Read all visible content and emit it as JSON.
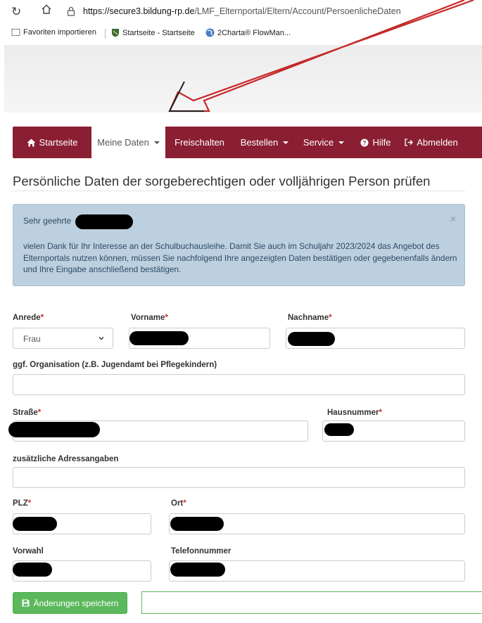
{
  "browser": {
    "url_host": "https://secure3.bildung-rp.de",
    "url_path": "/LMF_Elternportal/Eltern/Account/PersoenlicheDaten",
    "favorites": [
      {
        "label": "Favoriten importieren",
        "icon": "import-icon"
      },
      {
        "label": "Startseite - Startseite",
        "icon": "shield-icon"
      },
      {
        "label": "2Charta® FlowMan...",
        "icon": "globe-icon"
      }
    ]
  },
  "nav": {
    "items": [
      {
        "label": "Startseite",
        "icon": "home-icon"
      },
      {
        "label": "Meine Daten",
        "dropdown": true
      },
      {
        "label": "Freischalten"
      },
      {
        "label": "Bestellen",
        "dropdown": true
      },
      {
        "label": "Service",
        "dropdown": true
      },
      {
        "label": "Hilfe",
        "icon": "question-icon"
      },
      {
        "label": "Abmelden",
        "icon": "logout-icon"
      }
    ],
    "active": "Meine Daten",
    "color": "#8a1e33"
  },
  "page": {
    "title": "Persönliche Daten der sorgeberechtigen oder volljährigen Person prüfen"
  },
  "alert": {
    "greeting": "Sehr geehrte",
    "body": "vielen Dank für Ihr Interesse an der Schulbuchausleihe. Damit Sie auch im Schuljahr 2023/2024 das Angebot des Elternportals nutzen können, müssen Sie nachfolgend Ihre angezeigten Daten bestätigen oder gegebenenfalls ändern und Ihre Eingabe anschließend bestätigen.",
    "close": "×"
  },
  "form": {
    "anrede_label": "Anrede",
    "anrede_value": "Frau",
    "vorname_label": "Vorname",
    "nachname_label": "Nachname",
    "organisation_label": "ggf. Organisation (z.B. Jugendamt bei Pflegekindern)",
    "strasse_label": "Straße",
    "hausnummer_label": "Hausnummer",
    "zusatz_label": "zusätzliche Adressangaben",
    "plz_label": "PLZ",
    "ort_label": "Ort",
    "vorwahl_label": "Vorwahl",
    "telefon_label": "Telefonnummer",
    "required_mark": "*"
  },
  "actions": {
    "save_label": "Änderungen speichern"
  }
}
